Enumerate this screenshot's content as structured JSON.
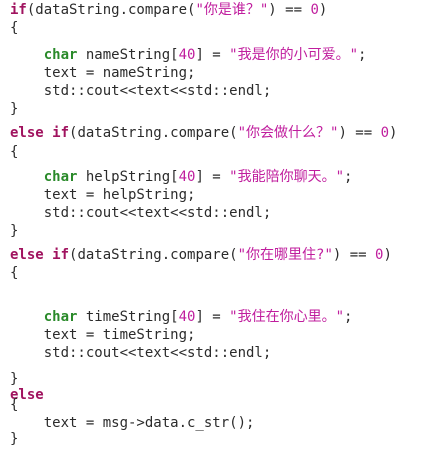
{
  "lines": [
    {
      "tokens": [
        {
          "t": "if",
          "c": "kw"
        },
        {
          "t": "(dataString.compare(",
          "c": "plain"
        },
        {
          "t": "\"你是谁？\"",
          "c": "str"
        },
        {
          "t": ") == ",
          "c": "plain"
        },
        {
          "t": "0",
          "c": "num"
        },
        {
          "t": ")",
          "c": "plain"
        }
      ]
    },
    {
      "tokens": [
        {
          "t": "{",
          "c": "plain"
        }
      ]
    },
    {
      "tokens": [
        {
          "t": "    ",
          "c": "plain"
        },
        {
          "t": "char",
          "c": "type"
        },
        {
          "t": " nameString[",
          "c": "plain"
        },
        {
          "t": "40",
          "c": "num"
        },
        {
          "t": "] = ",
          "c": "plain"
        },
        {
          "t": "\"我是你的小可爱。\"",
          "c": "str"
        },
        {
          "t": ";",
          "c": "plain"
        }
      ]
    },
    {
      "tokens": [
        {
          "t": "    text = nameString;",
          "c": "plain"
        }
      ]
    },
    {
      "tokens": [
        {
          "t": "    std::cout<<text<<std::endl;",
          "c": "plain"
        }
      ]
    },
    {
      "tokens": [
        {
          "t": "}",
          "c": "plain"
        }
      ]
    },
    {
      "tokens": [
        {
          "t": "else if",
          "c": "kw"
        },
        {
          "t": "(dataString.compare(",
          "c": "plain"
        },
        {
          "t": "\"你会做什么？\"",
          "c": "str"
        },
        {
          "t": ") == ",
          "c": "plain"
        },
        {
          "t": "0",
          "c": "num"
        },
        {
          "t": ")",
          "c": "plain"
        }
      ]
    },
    {
      "tokens": [
        {
          "t": "{",
          "c": "plain"
        }
      ]
    },
    {
      "tokens": [
        {
          "t": "    ",
          "c": "plain"
        },
        {
          "t": "char",
          "c": "type"
        },
        {
          "t": " helpString[",
          "c": "plain"
        },
        {
          "t": "40",
          "c": "num"
        },
        {
          "t": "] = ",
          "c": "plain"
        },
        {
          "t": "\"我能陪你聊天。\"",
          "c": "str"
        },
        {
          "t": ";",
          "c": "plain"
        }
      ]
    },
    {
      "tokens": [
        {
          "t": "    text = helpString;",
          "c": "plain"
        }
      ]
    },
    {
      "tokens": [
        {
          "t": "    std::cout<<text<<std::endl;",
          "c": "plain"
        }
      ]
    },
    {
      "tokens": [
        {
          "t": "}",
          "c": "plain"
        }
      ]
    },
    {
      "tokens": [
        {
          "t": "else if",
          "c": "kw"
        },
        {
          "t": "(dataString.compare(",
          "c": "plain"
        },
        {
          "t": "\"你在哪里住?\"",
          "c": "str"
        },
        {
          "t": ") == ",
          "c": "plain"
        },
        {
          "t": "0",
          "c": "num"
        },
        {
          "t": ")",
          "c": "plain"
        }
      ]
    },
    {
      "tokens": [
        {
          "t": "{",
          "c": "plain"
        }
      ]
    },
    {
      "tokens": []
    },
    {
      "tokens": [
        {
          "t": "    ",
          "c": "plain"
        },
        {
          "t": "char",
          "c": "type"
        },
        {
          "t": " timeString[",
          "c": "plain"
        },
        {
          "t": "40",
          "c": "num"
        },
        {
          "t": "] = ",
          "c": "plain"
        },
        {
          "t": "\"我住在你心里。\"",
          "c": "str"
        },
        {
          "t": ";",
          "c": "plain"
        }
      ]
    },
    {
      "tokens": [
        {
          "t": "    text = timeString;",
          "c": "plain"
        }
      ]
    },
    {
      "tokens": [
        {
          "t": "    std::cout<<text<<std::endl;",
          "c": "plain"
        }
      ]
    },
    {
      "tokens": [
        {
          "t": "}",
          "c": "plain"
        }
      ]
    },
    {
      "tokens": [
        {
          "t": "else",
          "c": "kw"
        }
      ]
    },
    {
      "tokens": [
        {
          "t": "{",
          "c": "plain"
        }
      ]
    },
    {
      "tokens": [
        {
          "t": "    text = msg->data.c_str();",
          "c": "plain"
        }
      ]
    },
    {
      "tokens": [
        {
          "t": "}",
          "c": "plain"
        }
      ]
    }
  ]
}
